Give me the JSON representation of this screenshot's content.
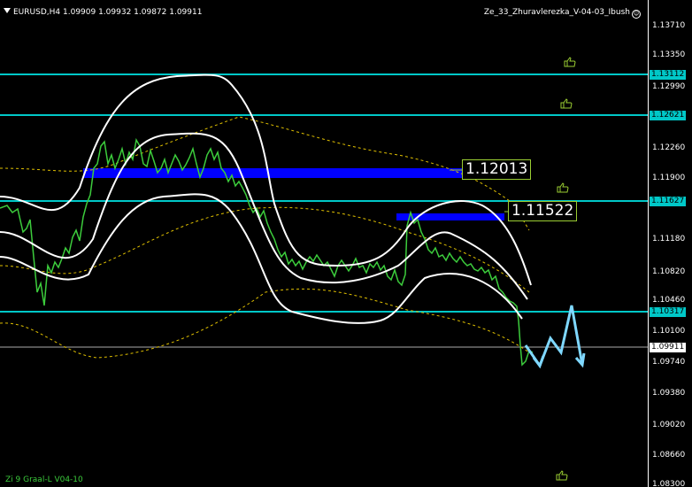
{
  "header": {
    "symbol": "EURUSD,H4",
    "ohlc": "1.09909 1.09932 1.09872 1.09911",
    "indicator": "Ze_33_Zhuravlerezka_V-04-03_Ibush"
  },
  "footer": {
    "label": "Zi 9 Graal-L V04-10"
  },
  "price_axis": {
    "ticks": [
      "1.13710",
      "1.13350",
      "1.12990",
      "1.12260",
      "1.11900",
      "1.11180",
      "1.10820",
      "1.10460",
      "1.10100",
      "1.09740",
      "1.09380",
      "1.09020",
      "1.08660",
      "1.08300"
    ],
    "level_tags": [
      "1.13112",
      "1.12621",
      "1.11627",
      "1.10317"
    ],
    "current_price": "1.09911"
  },
  "levels": {
    "upper_label": "1.12013",
    "lower_label": "1.11522"
  },
  "colors": {
    "background": "#000000",
    "level_line": "#00c8c8",
    "candle": "#3ccc3c",
    "band": "#ffffff",
    "marker": "#0000ff",
    "arrow": "#7fd8ff"
  },
  "icons": [
    "thumbs-up-icon",
    "smiley-icon",
    "dropdown-arrow-icon"
  ]
}
